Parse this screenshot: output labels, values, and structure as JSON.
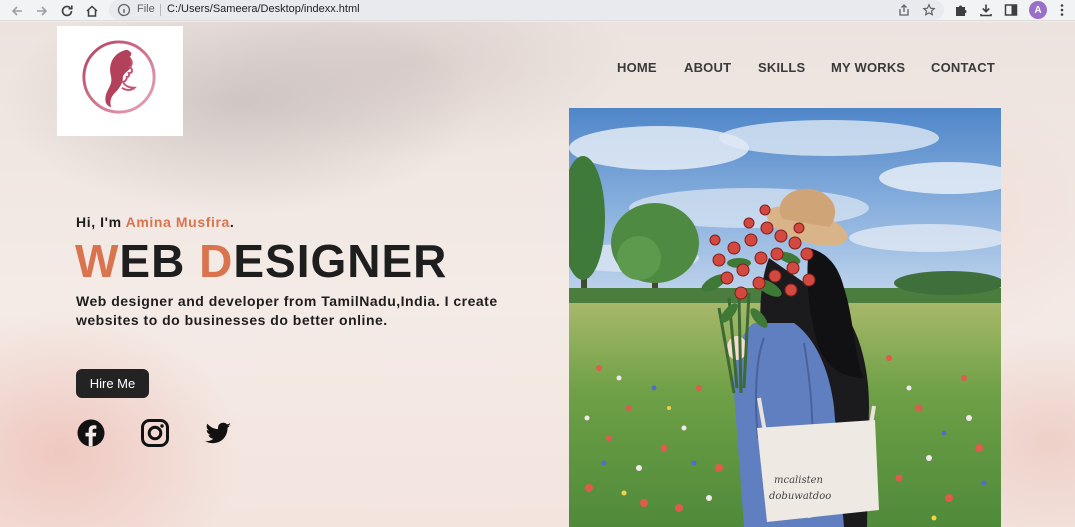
{
  "browser": {
    "file_label": "File",
    "url": "C:/Users/Sameera/Desktop/indexx.html",
    "profile_initial": "A"
  },
  "icons": {
    "back": "arrow-left-icon",
    "forward": "arrow-right-icon",
    "reload": "reload-icon",
    "home": "home-icon",
    "info": "info-icon",
    "share": "share-icon",
    "bookmark": "star-icon",
    "extensions": "puzzle-icon",
    "download": "download-icon",
    "sidebar": "sidebar-icon",
    "menu": "kebab-menu-icon",
    "logo": "woman-profile-logo-icon",
    "facebook": "facebook-icon",
    "instagram": "instagram-icon",
    "twitter": "twitter-icon"
  },
  "nav": {
    "items": [
      "HOME",
      "ABOUT",
      "SKILLS",
      "MY WORKS",
      "CONTACT"
    ]
  },
  "hero": {
    "greeting_prefix": "Hi, I'm ",
    "name": "Amina Musfira",
    "greeting_suffix": ".",
    "title_w": "W",
    "title_eb": "EB ",
    "title_d": "D",
    "title_esigner": "ESIGNER",
    "description": "Web designer and developer from TamilNadu,India. I create websites to do businesses do better online.",
    "button_label": "Hire Me"
  },
  "illustration": {
    "bag_text_1": "mcalisten",
    "bag_text_2": "dobuwatdoo"
  },
  "colors": {
    "accent": "#d9744e",
    "text": "#1e1e1e",
    "button_bg": "#232323",
    "logo_gradient_start": "#b4415c",
    "logo_gradient_end": "#e7a7bf"
  }
}
